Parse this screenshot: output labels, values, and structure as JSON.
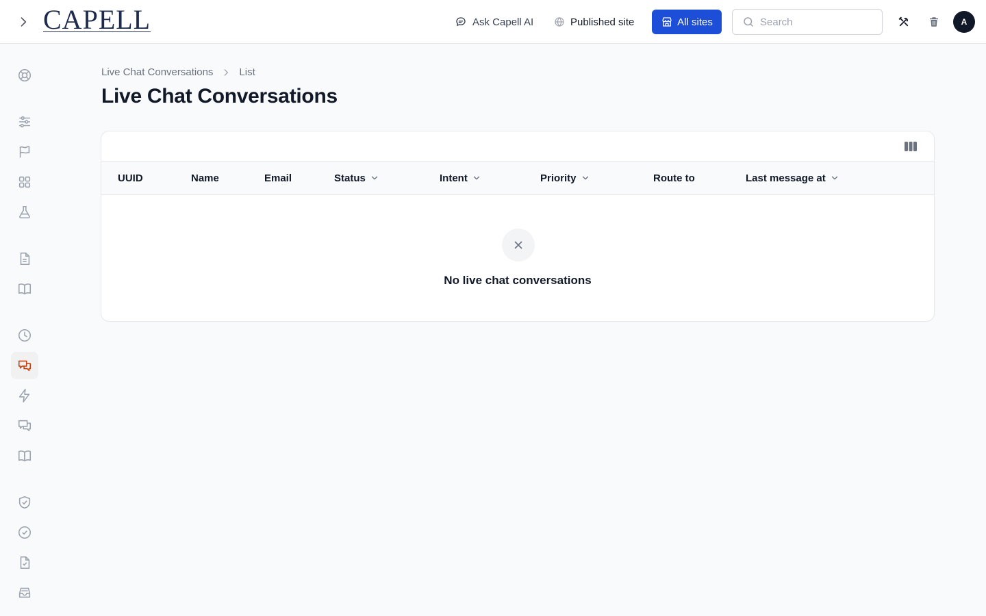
{
  "brand": {
    "logo_text": "CAPELL"
  },
  "topbar": {
    "ask_label": "Ask Capell AI",
    "published_label": "Published site",
    "all_sites_label": "All sites",
    "search_placeholder": "Search",
    "search_value": "",
    "avatar_initial": "A",
    "accent_color": "#1d4ed8"
  },
  "sidebar": {
    "active_color": "#c2410c",
    "items": [
      {
        "icon": "lifebuoy-icon"
      },
      {
        "icon": "sliders-icon"
      },
      {
        "icon": "flag-icon"
      },
      {
        "icon": "grid-icon"
      },
      {
        "icon": "flask-icon"
      },
      {
        "icon": "document-icon"
      },
      {
        "icon": "book-icon"
      },
      {
        "icon": "clock-icon"
      },
      {
        "icon": "chat-icon",
        "active": true
      },
      {
        "icon": "bolt-icon"
      },
      {
        "icon": "chat-bubbles-icon"
      },
      {
        "icon": "book-open-icon"
      },
      {
        "icon": "shield-check-icon"
      },
      {
        "icon": "check-circle-icon"
      },
      {
        "icon": "document-check-icon"
      },
      {
        "icon": "inbox-icon"
      }
    ]
  },
  "breadcrumb": {
    "parent": "Live Chat Conversations",
    "current": "List"
  },
  "page": {
    "title": "Live Chat Conversations"
  },
  "table": {
    "columns": [
      {
        "label": "UUID",
        "sortable": false
      },
      {
        "label": "Name",
        "sortable": false
      },
      {
        "label": "Email",
        "sortable": false
      },
      {
        "label": "Status",
        "sortable": true
      },
      {
        "label": "Intent",
        "sortable": true
      },
      {
        "label": "Priority",
        "sortable": true
      },
      {
        "label": "Route to",
        "sortable": false
      },
      {
        "label": "Last message at",
        "sortable": true
      }
    ],
    "empty_message": "No live chat conversations"
  }
}
